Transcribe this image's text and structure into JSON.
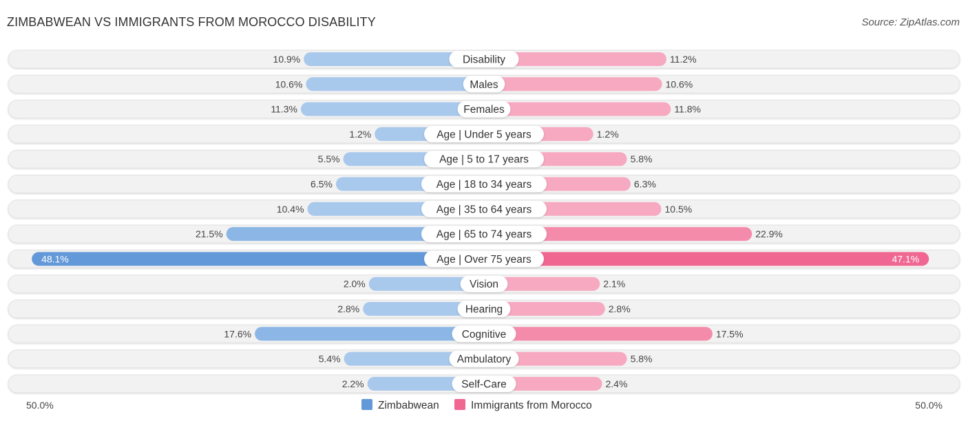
{
  "header": {
    "title": "ZIMBABWEAN VS IMMIGRANTS FROM MOROCCO DISABILITY",
    "source": "Source: ZipAtlas.com"
  },
  "colors": {
    "zimbabwean": "#6399d8",
    "zimbabwean_light": "#a8c8ec",
    "morocco": "#f06791",
    "morocco_light": "#f6a9c1",
    "row_bg": "#f2f2f2"
  },
  "chart_data": {
    "type": "bar",
    "orientation": "horizontal-diverging",
    "title": "ZIMBABWEAN VS IMMIGRANTS FROM MOROCCO DISABILITY",
    "categories": [
      "Disability",
      "Males",
      "Females",
      "Age | Under 5 years",
      "Age | 5 to 17 years",
      "Age | 18 to 34 years",
      "Age | 35 to 64 years",
      "Age | 65 to 74 years",
      "Age | Over 75 years",
      "Vision",
      "Hearing",
      "Cognitive",
      "Ambulatory",
      "Self-Care"
    ],
    "series": [
      {
        "name": "Zimbabwean",
        "side": "left",
        "values": [
          10.9,
          10.6,
          11.3,
          1.2,
          5.5,
          6.5,
          10.4,
          21.5,
          48.1,
          2.0,
          2.8,
          17.6,
          5.4,
          2.2
        ]
      },
      {
        "name": "Immigrants from Morocco",
        "side": "right",
        "values": [
          11.2,
          10.6,
          11.8,
          1.2,
          5.8,
          6.3,
          10.5,
          22.9,
          47.1,
          2.1,
          2.8,
          17.5,
          5.8,
          2.4
        ]
      }
    ],
    "value_suffix": "%",
    "axis": {
      "left_label": "50.0%",
      "right_label": "50.0%",
      "max": 50.0
    },
    "legend": {
      "placement": "bottom-center",
      "entries": [
        "Zimbabwean",
        "Immigrants from Morocco"
      ]
    }
  }
}
